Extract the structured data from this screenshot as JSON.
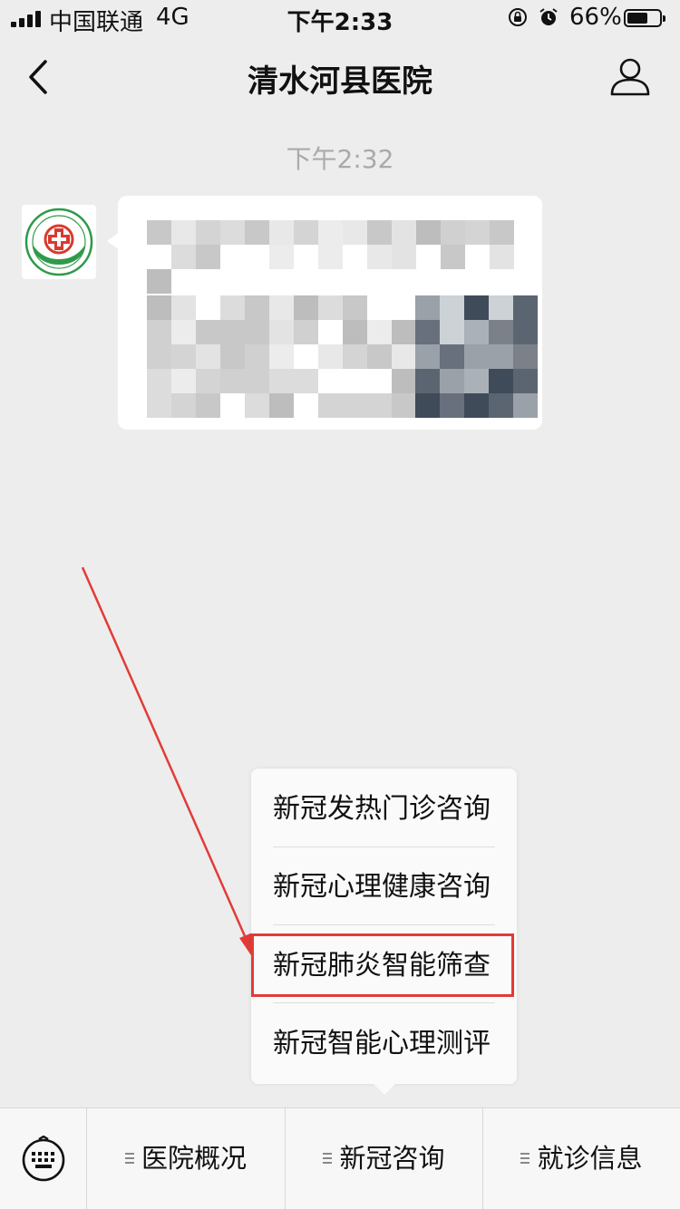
{
  "status_bar": {
    "carrier": "中国联通",
    "network": "4G",
    "time": "下午2:33",
    "battery_percent_text": "66%",
    "battery_level": 0.66
  },
  "nav": {
    "title": "清水河县医院",
    "back_icon": "chevron-left-icon",
    "profile_icon": "person-icon"
  },
  "chat": {
    "timestamp": "下午2:32"
  },
  "submenu": {
    "items": [
      "新冠发热门诊咨询",
      "新冠心理健康咨询",
      "新冠肺炎智能筛查",
      "新冠智能心理测评"
    ],
    "highlighted_index": 2
  },
  "bottom_menu": {
    "tabs": [
      "医院概况",
      "新冠咨询",
      "就诊信息"
    ]
  },
  "colors": {
    "background": "#ededed",
    "annotation_red": "#e23b37",
    "hospital_green": "#2e9a4a",
    "hospital_red": "#d83a2e"
  }
}
